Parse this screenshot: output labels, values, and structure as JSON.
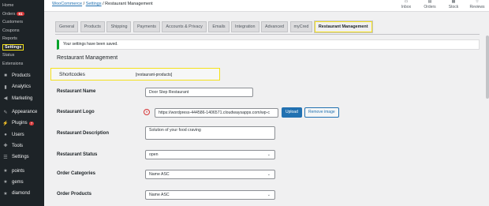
{
  "sidebar": {
    "sub_items": [
      "Home",
      "Orders",
      "Customers",
      "Coupons",
      "Reports",
      "Settings",
      "Status",
      "Extensions"
    ],
    "orders_badge": "61",
    "menu": [
      {
        "label": "Products",
        "icon": "box-icon"
      },
      {
        "label": "Analytics",
        "icon": "bar-chart-icon"
      },
      {
        "label": "Marketing",
        "icon": "megaphone-icon"
      },
      {
        "label": "Appearance",
        "icon": "brush-icon"
      },
      {
        "label": "Plugins",
        "icon": "plugin-icon"
      },
      {
        "label": "Users",
        "icon": "user-icon"
      },
      {
        "label": "Tools",
        "icon": "wrench-icon"
      },
      {
        "label": "Settings",
        "icon": "sliders-icon"
      },
      {
        "label": "points",
        "icon": "star-icon"
      },
      {
        "label": "gems",
        "icon": "star-icon"
      },
      {
        "label": "diamond",
        "icon": "star-icon"
      }
    ],
    "plugins_badge": "7"
  },
  "topbar": {
    "crumb_woo": "WooCommerce",
    "crumb_sep": "/",
    "crumb_settings": "Settings",
    "crumb_current": "Restaurant Management",
    "icons": [
      "Inbox",
      "Orders",
      "Stock",
      "Reviews"
    ]
  },
  "tabs": [
    "General",
    "Products",
    "Shipping",
    "Payments",
    "Accounts & Privacy",
    "Emails",
    "Integration",
    "Advanced",
    "myCred",
    "Restaurant Management"
  ],
  "notice": "Your settings have been saved.",
  "section_title": "Restaurant Management",
  "shortcodes": {
    "label": "Shortcodes",
    "value": "[restaurant-products]"
  },
  "fields": {
    "name_label": "Restaurant Name",
    "name_value": "Door Step Restaurant",
    "logo_label": "Restaurant Logo",
    "logo_url": "https://wordpress-444586-1406571.cloudwaysapps.com/wp-c",
    "upload_label": "Upload",
    "remove_label": "Remove image",
    "desc_label": "Restaurant Description",
    "desc_value": "Solution of your food craving",
    "status_label": "Restaurant Status",
    "status_value": "open",
    "categories_label": "Order Categories",
    "categories_value": "Name ASC",
    "products_label": "Order Products",
    "products_value": "Name ASC"
  },
  "colors": {
    "accent": "#2271b1",
    "highlight": "#f5e11a",
    "success": "#00a32a",
    "admin_dark": "#1d2327"
  }
}
